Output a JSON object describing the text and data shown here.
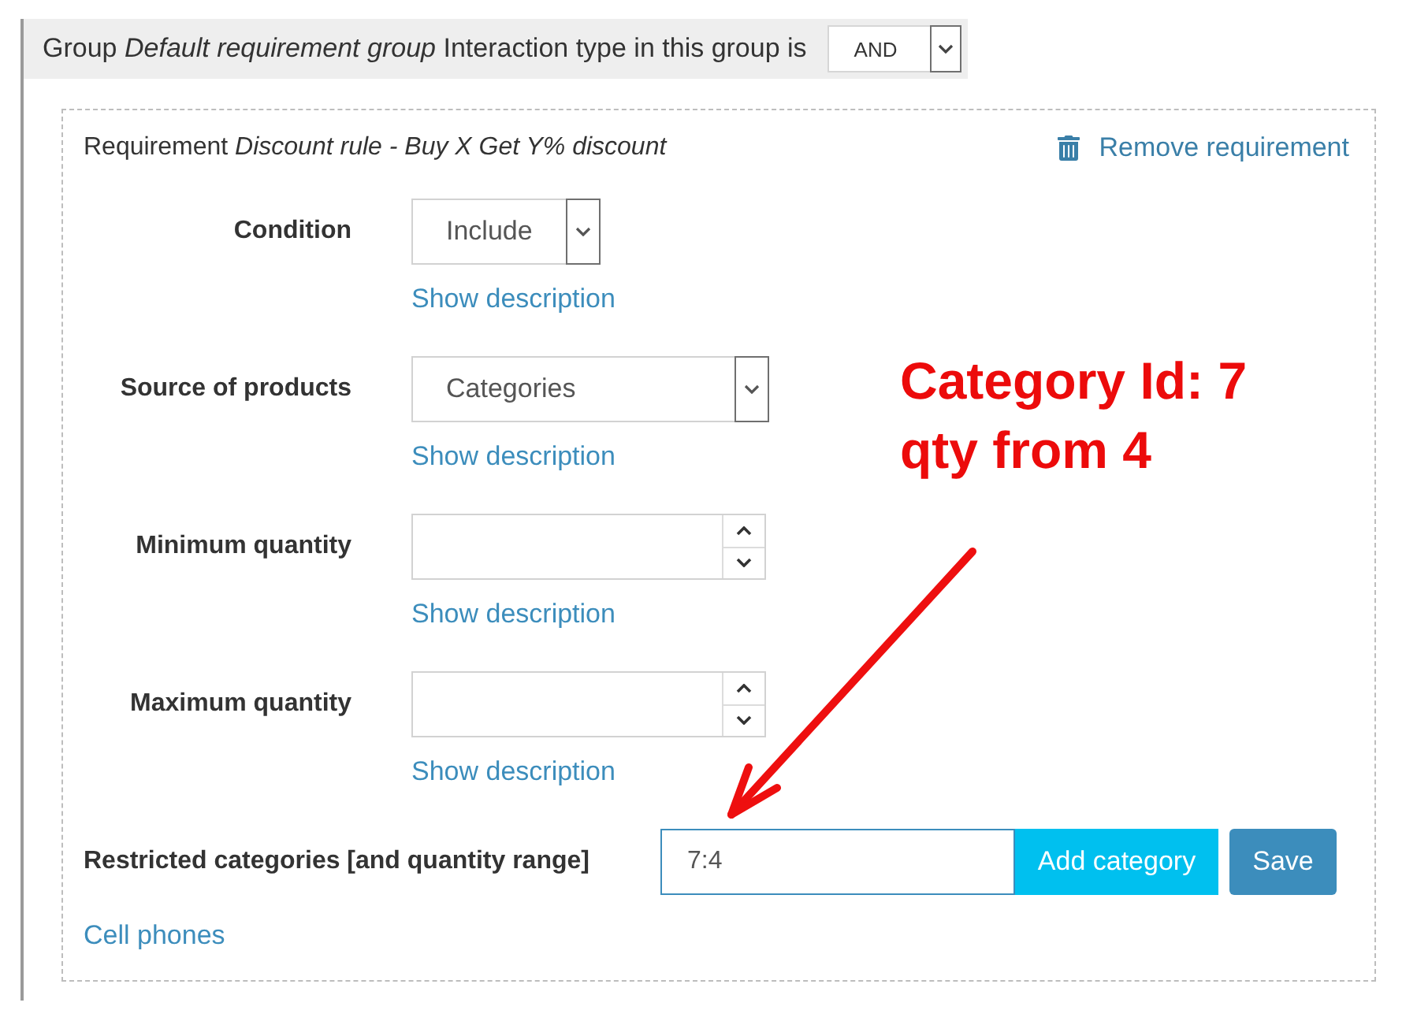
{
  "group": {
    "title": "Group *Default requirement group* Interaction type in this group is",
    "interaction_type": "AND"
  },
  "requirement": {
    "title": "Requirement *Discount rule - Buy X Get Y% discount*",
    "remove_link": "Remove requirement",
    "fields": [
      {
        "kind": "select",
        "label": "Condition",
        "value": "Include",
        "description_link": "Show description"
      },
      {
        "kind": "select",
        "label": "Source of products",
        "value": "Categories",
        "description_link": "Show description"
      },
      {
        "kind": "number",
        "label": "Minimum quantity",
        "description_link": "Show description"
      },
      {
        "kind": "number",
        "label": "Maximum quantity",
        "description_link": "Show description"
      }
    ],
    "restricted": {
      "label": "Restricted categories [and quantity range]",
      "value": "7:4",
      "add_button": "Add category",
      "save_button": "Save"
    },
    "categories": [
      "Cell phones"
    ]
  },
  "annotation": {
    "lines": [
      "Category Id: 7",
      "qty from 4"
    ]
  }
}
